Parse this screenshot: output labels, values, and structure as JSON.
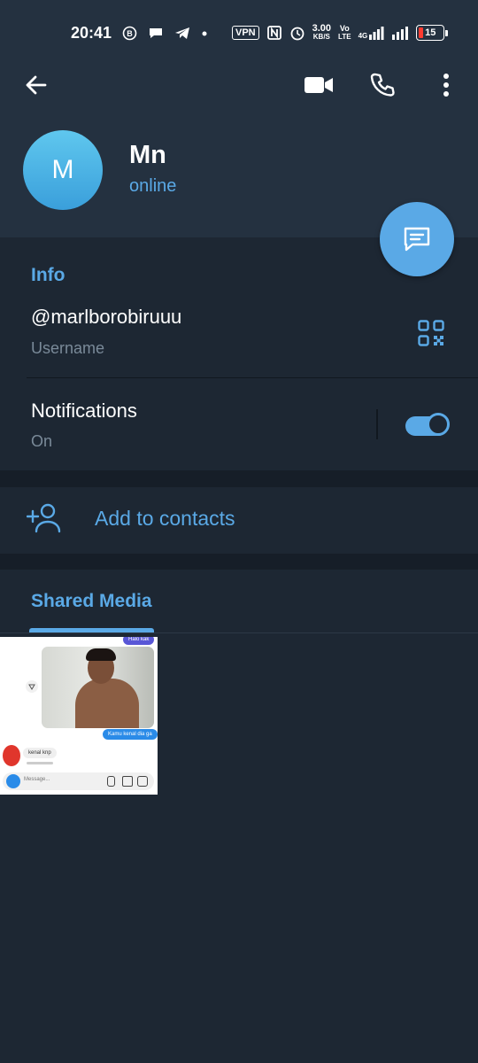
{
  "status_bar": {
    "time": "20:41",
    "vpn": "VPN",
    "speed_value": "3.00",
    "speed_unit": "KB/S",
    "volte_top": "Vo",
    "volte_bottom": "LTE",
    "network": "4G",
    "battery": "15"
  },
  "toolbar": {
    "back_icon": "arrow-left-icon",
    "video_icon": "video-camera-icon",
    "call_icon": "phone-icon",
    "menu_icon": "more-vertical-icon"
  },
  "profile": {
    "avatar_initial": "M",
    "name": "Mn",
    "status": "online"
  },
  "info": {
    "title": "Info",
    "username": "@marlborobiruuu",
    "username_caption": "Username",
    "notifications_label": "Notifications",
    "notifications_value": "On",
    "notifications_enabled": true
  },
  "add_contacts": {
    "label": "Add to contacts"
  },
  "shared_media": {
    "title": "Shared Media",
    "thumbnail": {
      "bubble_top": "Halo kak",
      "bubble_reply": "Kamu kenal dia ga",
      "bubble_incoming": "kenal knp",
      "input_placeholder": "Message..."
    }
  },
  "colors": {
    "accent": "#5aa9e6",
    "header_bg": "#243140",
    "page_bg": "#1d2733"
  }
}
